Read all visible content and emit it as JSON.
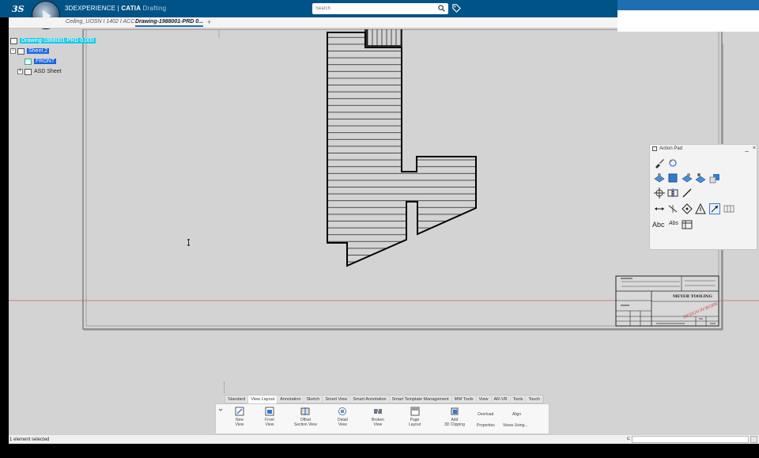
{
  "header": {
    "brand": "3DEXPERIENCE",
    "separator": " | ",
    "product": "CATIA",
    "app": "Drafting",
    "logo_icon": "ds-logo-icon",
    "compass_icon": "compass-icon",
    "tag_icon": "tag-icon",
    "accent": "#005386"
  },
  "search": {
    "placeholder": "Search",
    "value": ""
  },
  "tabs": [
    {
      "label": "Ceiling_UOSN I 1402 I ACC",
      "active": false
    },
    {
      "label": "Drawing-1988001-PRD 0...",
      "active": true
    },
    {
      "close": "×",
      "add": "+"
    }
  ],
  "tree": {
    "root": "Drawing-1988001-PRD 0.000",
    "sheet": "Sheet.2",
    "view": "FRONT",
    "asd": "ASD Sheet",
    "expander_minus": "−",
    "expander_plus": "+"
  },
  "title_block": {
    "stamp": "DESIGN IN WORK",
    "header_text": "MEYER TOOLING",
    "stamp_color": "#d64b4b"
  },
  "action_pad": {
    "title": "Action Pad",
    "minimize": "_",
    "close": "×",
    "text_icon": "Abc",
    "text_icon2": "Abs"
  },
  "ribbon": {
    "tabs": [
      {
        "label": "Standard",
        "active": false
      },
      {
        "label": "View Layout",
        "active": true
      },
      {
        "label": "Annotation",
        "active": false
      },
      {
        "label": "Sketch",
        "active": false
      },
      {
        "label": "Smart View",
        "active": false
      },
      {
        "label": "Smart Annotation",
        "active": false
      },
      {
        "label": "Smart Template Management",
        "active": false
      },
      {
        "label": "MW Tools",
        "active": false
      },
      {
        "label": "View",
        "active": false
      },
      {
        "label": "AR-VR",
        "active": false
      },
      {
        "label": "Tools",
        "active": false
      },
      {
        "label": "Touch",
        "active": false
      }
    ],
    "commands": {
      "new_view_1": "New",
      "new_view_2": "View",
      "front_view_1": "Front",
      "front_view_2": "View",
      "offset_1": "Offset",
      "offset_2": "Section View",
      "detail_1": "Detail",
      "detail_2": "View",
      "broken_1": "Broken",
      "broken_2": "View",
      "page_1": "Page",
      "page_2": "Layout",
      "add3d_1": "Add",
      "add3d_2": "3D Clipping",
      "overload": "Overload",
      "properties": "Properties",
      "align": "Align",
      "views_using": "Views Using..."
    }
  },
  "status": {
    "text": "1 element selected",
    "cmd_label": "c:"
  }
}
